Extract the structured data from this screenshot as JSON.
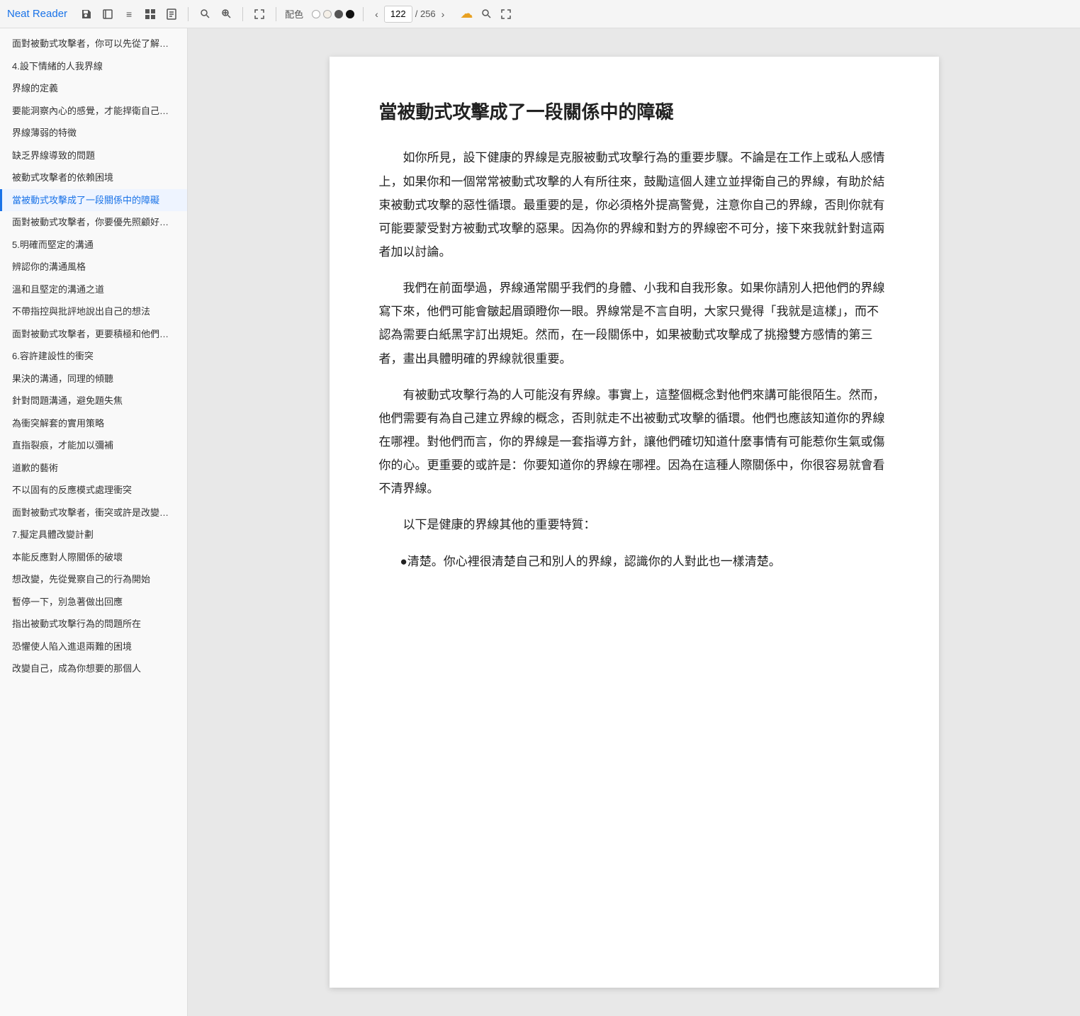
{
  "app": {
    "title": "Neat Reader"
  },
  "toolbar": {
    "save_icon": "💾",
    "book_icon": "📖",
    "menu_icon": "≡",
    "grid_icon": "⊞",
    "doc_icon": "▭",
    "search1_icon": "🔍",
    "search2_icon": "🔎",
    "fit_icon": "⤢",
    "color_label": "配色",
    "colors": [
      {
        "name": "white",
        "hex": "#ffffff",
        "border": "#ccc"
      },
      {
        "name": "beige",
        "hex": "#f5f0e8",
        "border": "#ccc"
      },
      {
        "name": "dark-gray",
        "hex": "#555555",
        "border": "#ccc"
      },
      {
        "name": "black",
        "hex": "#111111",
        "border": "#555"
      }
    ],
    "prev_icon": "‹",
    "page_current": "122",
    "page_total": "256",
    "next_icon": "›",
    "cloud_icon": "☁",
    "search_icon": "🔍",
    "fullscreen_icon": "⛶"
  },
  "sidebar": {
    "items": [
      {
        "label": "面對被動式攻擊者，你可以先從了解自己和對...",
        "active": false
      },
      {
        "label": "4.設下情緒的人我界線",
        "active": false
      },
      {
        "label": "界線的定義",
        "active": false
      },
      {
        "label": "要能洞察內心的感覺，才能捍衛自己的界線",
        "active": false
      },
      {
        "label": "界線薄弱的特徵",
        "active": false
      },
      {
        "label": "缺乏界線導致的問題",
        "active": false
      },
      {
        "label": "被動式攻擊者的依賴困境",
        "active": false
      },
      {
        "label": "當被動式攻擊成了一段關係中的障礙",
        "active": true
      },
      {
        "label": "面對被動式攻擊者，你要優先照顧好自己",
        "active": false
      },
      {
        "label": "5.明確而堅定的溝通",
        "active": false
      },
      {
        "label": "辨認你的溝通風格",
        "active": false
      },
      {
        "label": "溫和且堅定的溝通之道",
        "active": false
      },
      {
        "label": "不帶指控與批評地說出自己的想法",
        "active": false
      },
      {
        "label": "面對被動式攻擊者，更要積極和他們溝通",
        "active": false
      },
      {
        "label": "6.容許建設性的衝突",
        "active": false
      },
      {
        "label": "果決的溝通，同理的傾聽",
        "active": false
      },
      {
        "label": "針對問題溝通，避免題失焦",
        "active": false
      },
      {
        "label": "為衝突解套的實用策略",
        "active": false
      },
      {
        "label": "直指裂痕，才能加以彌補",
        "active": false
      },
      {
        "label": "道歉的藝術",
        "active": false
      },
      {
        "label": "不以固有的反應模式處理衝突",
        "active": false
      },
      {
        "label": "面對被動式攻擊者，衝突或許是改變關係的良機",
        "active": false
      },
      {
        "label": "7.擬定具體改變計劃",
        "active": false
      },
      {
        "label": "本能反應對人際關係的破壞",
        "active": false
      },
      {
        "label": "想改變，先從覺察自己的行為開始",
        "active": false
      },
      {
        "label": "暫停一下，別急著做出回應",
        "active": false
      },
      {
        "label": "指出被動式攻擊行為的問題所在",
        "active": false
      },
      {
        "label": "恐懼使人陷入進退兩難的困境",
        "active": false
      },
      {
        "label": "改變自己，成為你想要的那個人",
        "active": false
      }
    ]
  },
  "page": {
    "title": "當被動式攻擊成了一段關係中的障礙",
    "paragraphs": [
      "如你所見，設下健康的界線是克服被動式攻擊行為的重要步驟。不論是在工作上或私人感情上，如果你和一個常常被動式攻擊的人有所往來，鼓勵這個人建立並捍衛自己的界線，有助於結束被動式攻擊的惡性循環。最重要的是，你必須格外提高警覺，注意你自己的界線，否則你就有可能要蒙受對方被動式攻擊的惡果。因為你的界線和對方的界線密不可分，接下來我就針對這兩者加以討論。",
      "我們在前面學過，界線通常關乎我們的身體、小我和自我形象。如果你請別人把他們的界線寫下來，他們可能會皺起眉頭瞪你一眼。界線常是不言自明，大家只覺得「我就是這樣」，而不認為需要白紙黑字訂出規矩。然而，在一段關係中，如果被動式攻擊成了挑撥雙方感情的第三者，畫出具體明確的界線就很重要。",
      "有被動式攻擊行為的人可能沒有界線。事實上，這整個概念對他們來講可能很陌生。然而，他們需要有為自己建立界線的概念，否則就走不出被動式攻擊的循環。他們也應該知道你的界線在哪裡。對他們而言，你的界線是一套指導方針，讓他們確切知道什麼事情有可能惹你生氣或傷你的心。更重要的或許是：你要知道你的界線在哪裡。因為在這種人際關係中，你很容易就會看不清界線。",
      "以下是健康的界線其他的重要特質："
    ],
    "bullets": [
      "●清楚。你心裡很清楚自己和別人的界線，認識你的人對此也一樣清楚。"
    ]
  }
}
